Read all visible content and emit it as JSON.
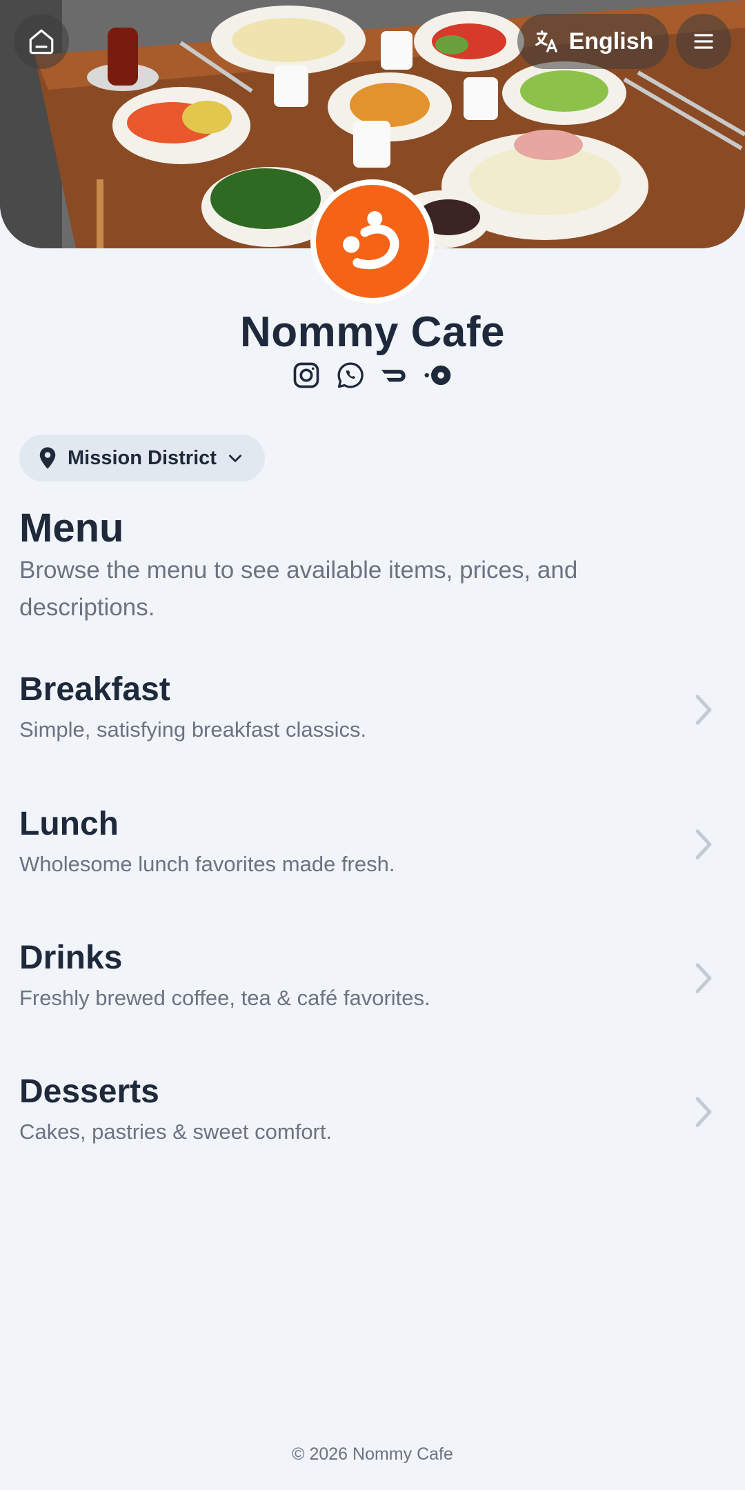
{
  "header": {
    "language": "English"
  },
  "cafe": {
    "name": "Nommy Cafe",
    "socials": [
      "instagram-icon",
      "whatsapp-icon",
      "doordash-icon",
      "ubereats-icon"
    ]
  },
  "location": {
    "selected": "Mission District"
  },
  "menu": {
    "title": "Menu",
    "description": "Browse the menu to see available items, prices, and descriptions.",
    "categories": [
      {
        "name": "Breakfast",
        "description": "Simple, satisfying breakfast classics."
      },
      {
        "name": "Lunch",
        "description": "Wholesome lunch favorites made fresh."
      },
      {
        "name": "Drinks",
        "description": "Freshly brewed coffee, tea & café favorites."
      },
      {
        "name": "Desserts",
        "description": "Cakes, pastries & sweet comfort."
      }
    ]
  },
  "footer": {
    "copyright": "© 2026 Nommy Cafe"
  },
  "colors": {
    "brand": "#f56416",
    "background": "#f1f4f9",
    "text": "#1e293b",
    "muted": "#6b7280"
  }
}
